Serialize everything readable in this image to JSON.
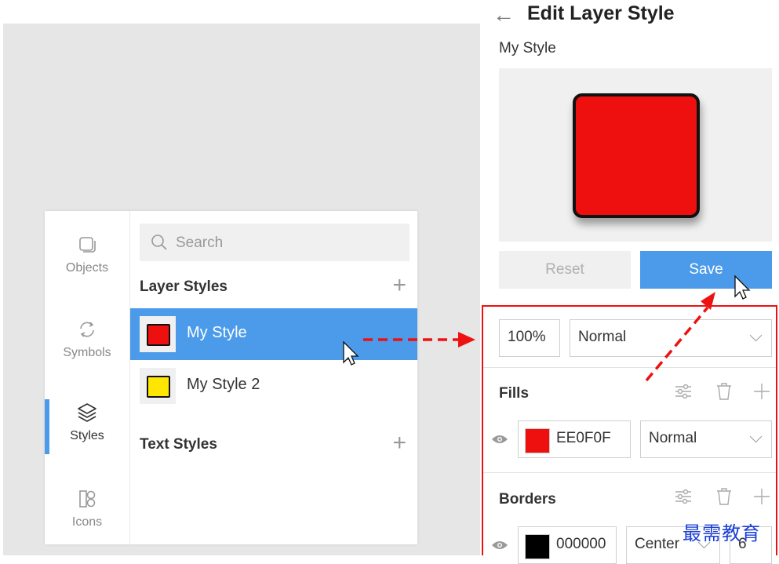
{
  "library": {
    "nav": [
      {
        "label": "Objects",
        "icon": "objects-icon"
      },
      {
        "label": "Symbols",
        "icon": "symbols-icon"
      },
      {
        "label": "Styles",
        "icon": "styles-icon",
        "active": true
      },
      {
        "label": "Icons",
        "icon": "icons-icon"
      }
    ],
    "search": {
      "placeholder": "Search"
    },
    "layer_styles": {
      "title": "Layer Styles",
      "items": [
        {
          "label": "My Style",
          "swatch": "#EE0F0F",
          "selected": true
        },
        {
          "label": "My Style 2",
          "swatch": "#FFE600",
          "selected": false
        }
      ]
    },
    "text_styles": {
      "title": "Text Styles"
    }
  },
  "inspector": {
    "title": "Edit Layer Style",
    "style_name": "My Style",
    "preview": {
      "fill": "#EE0F0F",
      "border": "#111111"
    },
    "reset_label": "Reset",
    "save_label": "Save",
    "opacity": "100%",
    "blend_mode": "Normal",
    "fills": {
      "title": "Fills",
      "items": [
        {
          "hex": "EE0F0F",
          "color": "#EE0F0F",
          "blend": "Normal"
        }
      ]
    },
    "borders": {
      "title": "Borders",
      "items": [
        {
          "hex": "000000",
          "color": "#000000",
          "position": "Center",
          "width": "6"
        }
      ]
    }
  },
  "watermark": "最需教育",
  "colors": {
    "accent": "#4B9BEA",
    "annotation": "#EE1111"
  }
}
